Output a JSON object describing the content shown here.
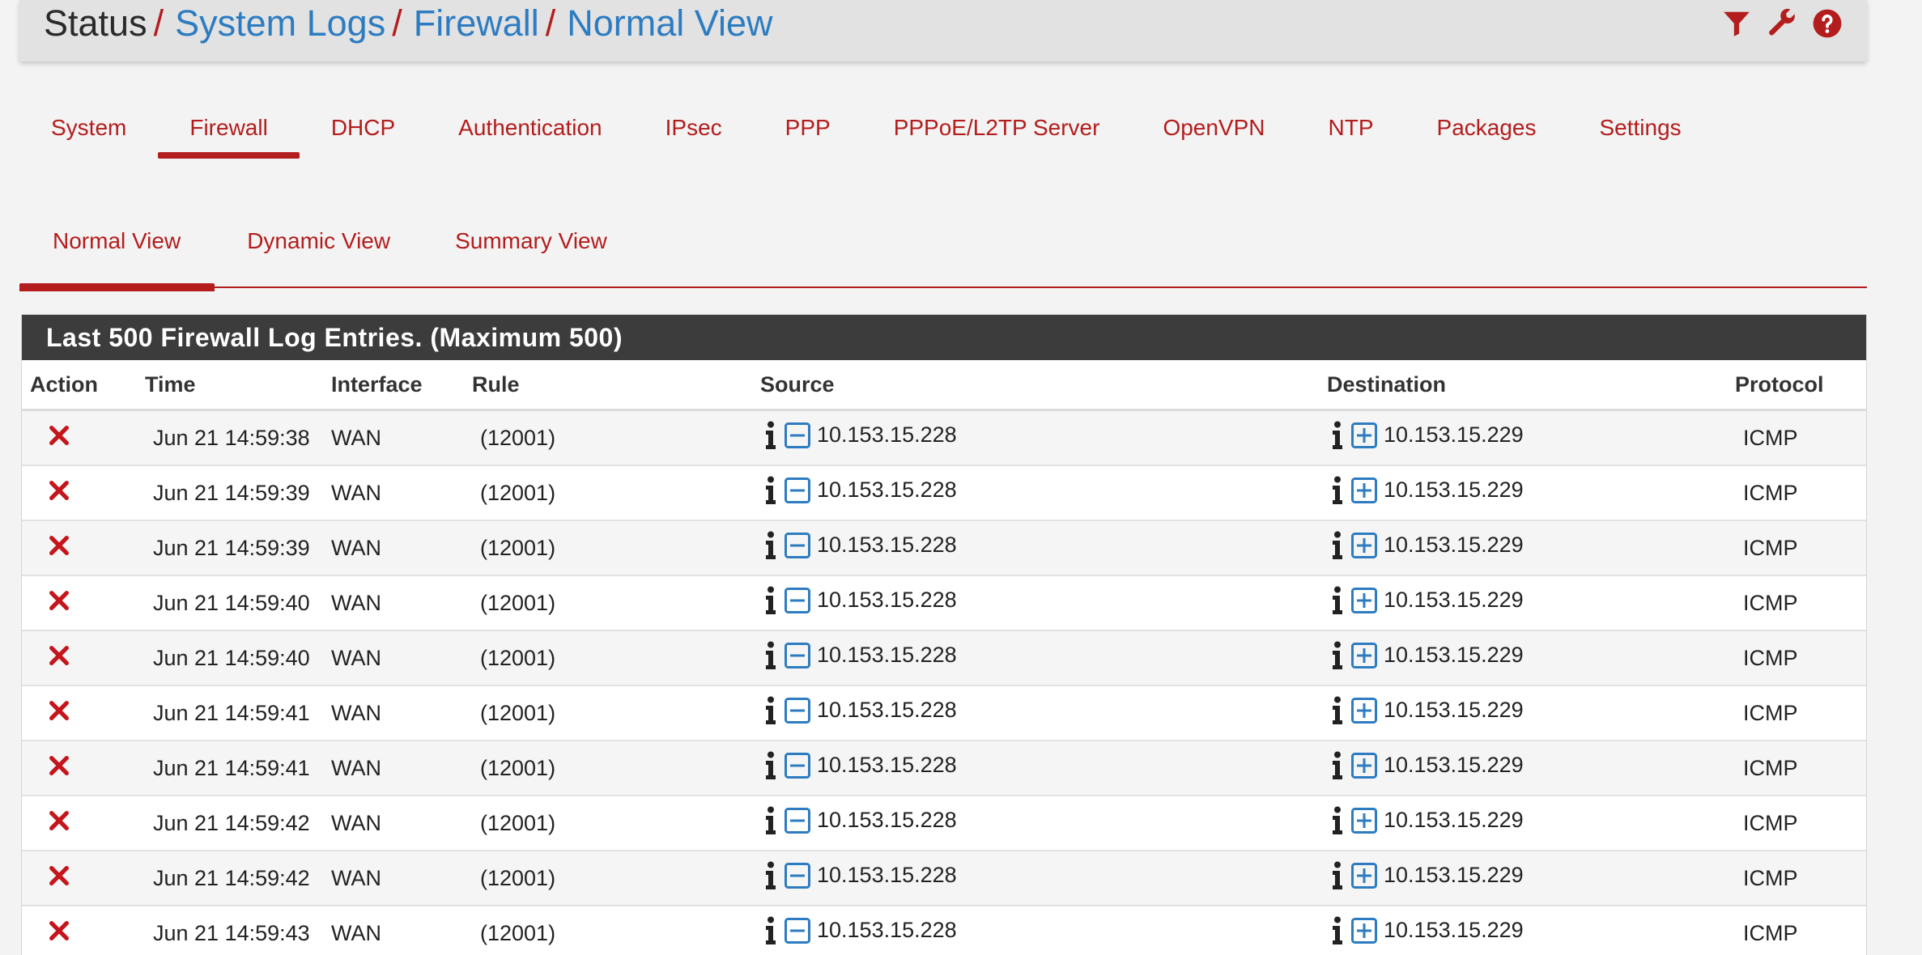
{
  "breadcrumb": {
    "items": [
      {
        "label": "Status",
        "sep": "/"
      },
      {
        "label": "System Logs",
        "sep": "/"
      },
      {
        "label": "Firewall",
        "sep": "/"
      },
      {
        "label": "Normal View",
        "sep": ""
      }
    ],
    "actions": [
      "filter-icon",
      "wrench-icon",
      "help-icon"
    ]
  },
  "tabs": [
    {
      "label": "System"
    },
    {
      "label": "Firewall",
      "active": true
    },
    {
      "label": "DHCP"
    },
    {
      "label": "Authentication"
    },
    {
      "label": "IPsec"
    },
    {
      "label": "PPP"
    },
    {
      "label": "PPPoE/L2TP Server"
    },
    {
      "label": "OpenVPN"
    },
    {
      "label": "NTP"
    },
    {
      "label": "Packages"
    },
    {
      "label": "Settings"
    }
  ],
  "subtabs": [
    {
      "label": "Normal View",
      "active": true
    },
    {
      "label": "Dynamic View"
    },
    {
      "label": "Summary View"
    }
  ],
  "panel": {
    "title": "Last 500 Firewall Log Entries. (Maximum 500)"
  },
  "table": {
    "headers": {
      "action": "Action",
      "time": "Time",
      "interface": "Interface",
      "rule": "Rule",
      "source": "Source",
      "destination": "Destination",
      "protocol": "Protocol"
    },
    "rows": [
      {
        "action": "block",
        "time": "Jun 21 14:59:38",
        "interface": "WAN",
        "rule": "(12001)",
        "source": "10.153.15.228",
        "destination": "10.153.15.229",
        "protocol": "ICMP"
      },
      {
        "action": "block",
        "time": "Jun 21 14:59:39",
        "interface": "WAN",
        "rule": "(12001)",
        "source": "10.153.15.228",
        "destination": "10.153.15.229",
        "protocol": "ICMP"
      },
      {
        "action": "block",
        "time": "Jun 21 14:59:39",
        "interface": "WAN",
        "rule": "(12001)",
        "source": "10.153.15.228",
        "destination": "10.153.15.229",
        "protocol": "ICMP"
      },
      {
        "action": "block",
        "time": "Jun 21 14:59:40",
        "interface": "WAN",
        "rule": "(12001)",
        "source": "10.153.15.228",
        "destination": "10.153.15.229",
        "protocol": "ICMP"
      },
      {
        "action": "block",
        "time": "Jun 21 14:59:40",
        "interface": "WAN",
        "rule": "(12001)",
        "source": "10.153.15.228",
        "destination": "10.153.15.229",
        "protocol": "ICMP"
      },
      {
        "action": "block",
        "time": "Jun 21 14:59:41",
        "interface": "WAN",
        "rule": "(12001)",
        "source": "10.153.15.228",
        "destination": "10.153.15.229",
        "protocol": "ICMP"
      },
      {
        "action": "block",
        "time": "Jun 21 14:59:41",
        "interface": "WAN",
        "rule": "(12001)",
        "source": "10.153.15.228",
        "destination": "10.153.15.229",
        "protocol": "ICMP"
      },
      {
        "action": "block",
        "time": "Jun 21 14:59:42",
        "interface": "WAN",
        "rule": "(12001)",
        "source": "10.153.15.228",
        "destination": "10.153.15.229",
        "protocol": "ICMP"
      },
      {
        "action": "block",
        "time": "Jun 21 14:59:42",
        "interface": "WAN",
        "rule": "(12001)",
        "source": "10.153.15.228",
        "destination": "10.153.15.229",
        "protocol": "ICMP"
      },
      {
        "action": "block",
        "time": "Jun 21 14:59:43",
        "interface": "WAN",
        "rule": "(12001)",
        "source": "10.153.15.228",
        "destination": "10.153.15.229",
        "protocol": "ICMP"
      }
    ]
  },
  "colors": {
    "accent_red": "#b31d1d",
    "link_blue": "#2d7cc1",
    "panel_header": "#3c3c3c"
  }
}
